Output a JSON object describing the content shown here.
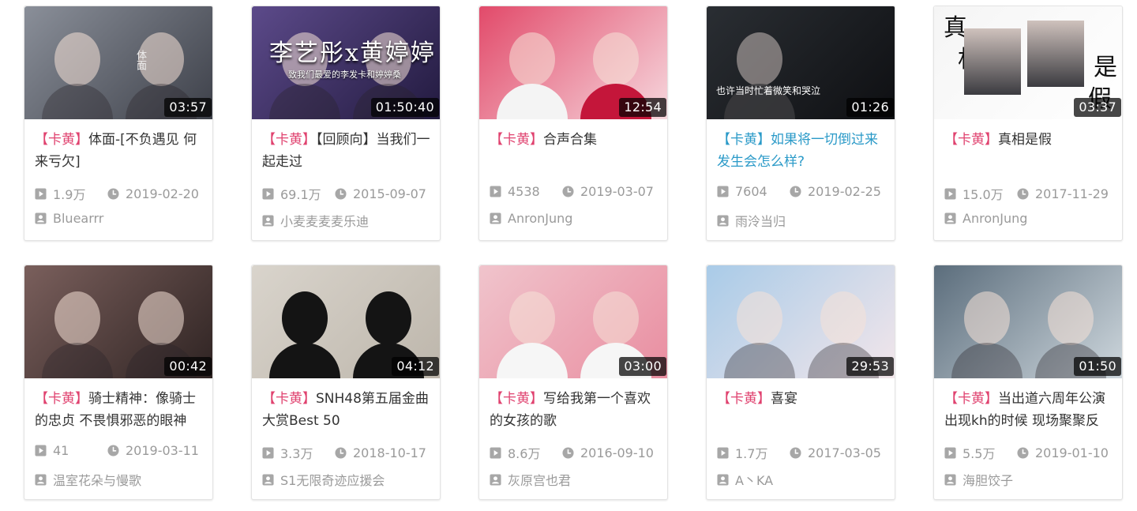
{
  "videos": [
    {
      "tag": "卡黄",
      "title": "体面-[不负遇见 何来亏欠]",
      "duration": "03:57",
      "plays": "1.9万",
      "date": "2019-02-20",
      "uploader": "Bluearrr",
      "thumb_colors": [
        "#8a8f99",
        "#3d4049"
      ],
      "caption": "体面"
    },
    {
      "tag": "卡黄",
      "title": "【回顾向】当我们一起走过",
      "duration": "01:50:40",
      "plays": "69.1万",
      "date": "2015-09-07",
      "uploader": "小麦麦麦麦乐迪",
      "thumb_colors": [
        "#5c4a8a",
        "#221a3f"
      ],
      "caption": "李艺彤x黄婷婷",
      "subcaption": "致我们最爱的李发卡和婷婷桑"
    },
    {
      "tag": "卡黄",
      "title": "合声合集",
      "duration": "12:54",
      "plays": "4538",
      "date": "2019-03-07",
      "uploader": "AnronJung",
      "thumb_colors": [
        "#e24a6a",
        "#f6d8de"
      ]
    },
    {
      "tag": "卡黄",
      "title": "如果将一切倒过来发生会怎么样?",
      "duration": "01:26",
      "plays": "7604",
      "date": "2019-02-25",
      "uploader": "雨泠当归",
      "thumb_colors": [
        "#2a2e33",
        "#0e0f12"
      ],
      "caption": "也许当时忙着微笑和哭泣",
      "active": true
    },
    {
      "tag": "卡黄",
      "title": "真相是假",
      "duration": "03:37",
      "plays": "15.0万",
      "date": "2017-11-29",
      "uploader": "AnronJung",
      "thumb_colors": [
        "#f5f5f5",
        "#ffffff"
      ],
      "caption_chars": [
        "真",
        "相",
        "是",
        "假"
      ]
    },
    {
      "tag": "卡黄",
      "title": "骑士精神：像骑士的忠贞 不畏惧邪恶的眼神",
      "duration": "00:42",
      "plays": "41",
      "date": "2019-03-11",
      "uploader": "温室花朵与慢歌",
      "thumb_colors": [
        "#7a5f5c",
        "#2e2322"
      ]
    },
    {
      "tag": "卡黄",
      "title": "SNH48第五届金曲大赏Best 50",
      "duration": "04:12",
      "plays": "3.3万",
      "date": "2018-10-17",
      "uploader": "S1无限奇迹应援会",
      "thumb_colors": [
        "#d9d4cc",
        "#bdb6ab"
      ]
    },
    {
      "tag": "卡黄",
      "title": "写给我第一个喜欢的女孩的歌",
      "duration": "03:00",
      "plays": "8.6万",
      "date": "2016-09-10",
      "uploader": "灰原宫也君",
      "thumb_colors": [
        "#f0c4cc",
        "#e98da0"
      ]
    },
    {
      "tag": "卡黄",
      "title": "喜宴",
      "duration": "29:53",
      "plays": "1.7万",
      "date": "2017-03-05",
      "uploader": "A丶KA",
      "thumb_colors": [
        "#a9cbe8",
        "#f3e6ea"
      ]
    },
    {
      "tag": "卡黄",
      "title": "当出道六周年公演出现kh的时候 现场聚聚反应",
      "duration": "01:50",
      "plays": "5.5万",
      "date": "2019-01-10",
      "uploader": "海胆饺子",
      "thumb_colors": [
        "#5b6d7c",
        "#cfd8de"
      ]
    }
  ],
  "icons": {
    "plays": "play-icon",
    "date": "clock-icon",
    "uploader": "user-icon"
  },
  "colors": {
    "tag": "#e0426f",
    "active_title": "#2b9ac8",
    "meta": "#9a9a9a",
    "title": "#333333"
  }
}
